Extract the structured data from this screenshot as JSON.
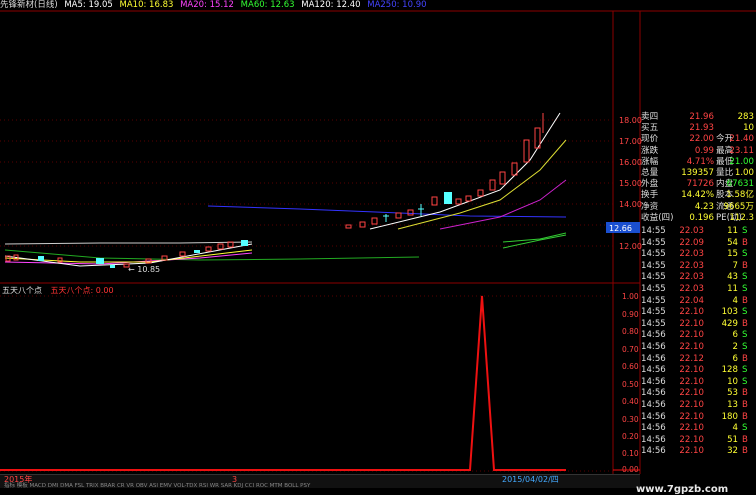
{
  "window": {
    "title": "先锋新材(日线)"
  },
  "ma_legend": [
    {
      "label": "MA5: 19.05",
      "color": "#ffffff"
    },
    {
      "label": "MA10: 16.83",
      "color": "#ffff33"
    },
    {
      "label": "MA20: 15.12",
      "color": "#ff44ff"
    },
    {
      "label": "MA60: 12.63",
      "color": "#33ff33"
    },
    {
      "label": "MA120: 12.40",
      "color": "#ffffff"
    },
    {
      "label": "MA250: 10.90",
      "color": "#4444ff"
    }
  ],
  "price_axis": {
    "ticks": [
      "18.00",
      "17.00",
      "16.00",
      "15.00",
      "14.00",
      "13.00",
      "12.00"
    ],
    "current": "12.66"
  },
  "indicator_axis": {
    "ticks": [
      "1.00",
      "0.90",
      "0.80",
      "0.70",
      "0.60",
      "0.50",
      "0.40",
      "0.30",
      "0.20",
      "0.10",
      "0.00"
    ]
  },
  "chart_labels": {
    "low_marker": "← 10.85",
    "indicator_name": "五天八个点",
    "indicator_value": "五天八个点: 0.00"
  },
  "bottom": {
    "year": "2015年",
    "date_tag": "2015/04/02/四",
    "cursor_marker": "3",
    "tabs": "指标 模板 MACD DMI DMA FSL TRIX BRAR CR VR OBV ASI EMV VOL-TDX RSI WR SAR KDJ CCI ROC MTM BOLL PSY"
  },
  "watermark": "www.7gpzb.com",
  "quote_rows": [
    {
      "label": "卖四",
      "value": "21.96",
      "label2": "",
      "value2": "283",
      "vcolor": "#ff4444",
      "v2color": "#ffff33"
    },
    {
      "label": "买五",
      "value": "21.93",
      "label2": "",
      "value2": "10",
      "vcolor": "#ff4444",
      "v2color": "#ffff33"
    },
    {
      "label": "现价",
      "value": "22.00",
      "label2": "今开",
      "value2": "21.40",
      "vcolor": "#ff4444",
      "v2color": "#ff4444"
    },
    {
      "label": "涨跌",
      "value": "0.99",
      "label2": "最高",
      "value2": "23.11",
      "vcolor": "#ff4444",
      "v2color": "#ff4444"
    },
    {
      "label": "涨幅",
      "value": "4.71%",
      "label2": "最低",
      "value2": "21.00",
      "vcolor": "#ff4444",
      "v2color": "#33ff33"
    },
    {
      "label": "总量",
      "value": "139357",
      "label2": "量比",
      "value2": "1.00",
      "vcolor": "#ffff33",
      "v2color": "#ffff33"
    },
    {
      "label": "外盘",
      "value": "71726",
      "label2": "内盘",
      "value2": "67631",
      "vcolor": "#ff4444",
      "v2color": "#33ff33"
    },
    {
      "label": "换手",
      "value": "14.42%",
      "label2": "股本",
      "value2": "1.58亿",
      "vcolor": "#ffff33",
      "v2color": "#ffff33"
    },
    {
      "label": "净资",
      "value": "4.23",
      "label2": "流通",
      "value2": "9665万",
      "vcolor": "#ffff33",
      "v2color": "#ffff33"
    },
    {
      "label": "收益(四)",
      "value": "0.196",
      "label2": "PE(动)",
      "value2": "112.3",
      "vcolor": "#ffff33",
      "v2color": "#ffff33"
    }
  ],
  "trades": [
    {
      "time": "14:55",
      "price": "22.03",
      "vol": "11",
      "side": "S"
    },
    {
      "time": "14:55",
      "price": "22.09",
      "vol": "54",
      "side": "B"
    },
    {
      "time": "14:55",
      "price": "22.03",
      "vol": "15",
      "side": "S"
    },
    {
      "time": "14:55",
      "price": "22.03",
      "vol": "7",
      "side": "B"
    },
    {
      "time": "14:55",
      "price": "22.03",
      "vol": "43",
      "side": "S"
    },
    {
      "time": "14:55",
      "price": "22.03",
      "vol": "11",
      "side": "S"
    },
    {
      "time": "14:55",
      "price": "22.04",
      "vol": "4",
      "side": "B"
    },
    {
      "time": "14:55",
      "price": "22.10",
      "vol": "103",
      "side": "S"
    },
    {
      "time": "14:55",
      "price": "22.10",
      "vol": "429",
      "side": "B"
    },
    {
      "time": "14:56",
      "price": "22.10",
      "vol": "6",
      "side": "S"
    },
    {
      "time": "14:56",
      "price": "22.10",
      "vol": "2",
      "side": "S"
    },
    {
      "time": "14:56",
      "price": "22.12",
      "vol": "6",
      "side": "B"
    },
    {
      "time": "14:56",
      "price": "22.10",
      "vol": "128",
      "side": "S"
    },
    {
      "time": "14:56",
      "price": "22.10",
      "vol": "10",
      "side": "S"
    },
    {
      "time": "14:56",
      "price": "22.10",
      "vol": "53",
      "side": "B"
    },
    {
      "time": "14:56",
      "price": "22.10",
      "vol": "13",
      "side": "B"
    },
    {
      "time": "14:56",
      "price": "22.10",
      "vol": "180",
      "side": "B"
    },
    {
      "time": "14:56",
      "price": "22.10",
      "vol": "4",
      "side": "S"
    },
    {
      "time": "14:56",
      "price": "22.10",
      "vol": "51",
      "side": "B"
    },
    {
      "time": "14:56",
      "price": "22.10",
      "vol": "32",
      "side": "B"
    }
  ],
  "chart_data": {
    "type": "candlestick",
    "ma_series": [
      "MA5",
      "MA10",
      "MA20",
      "MA60",
      "MA120",
      "MA250"
    ],
    "indicator": {
      "name": "五天八个点",
      "type": "line",
      "peak_value": 1.0,
      "baseline": 0.0
    }
  }
}
